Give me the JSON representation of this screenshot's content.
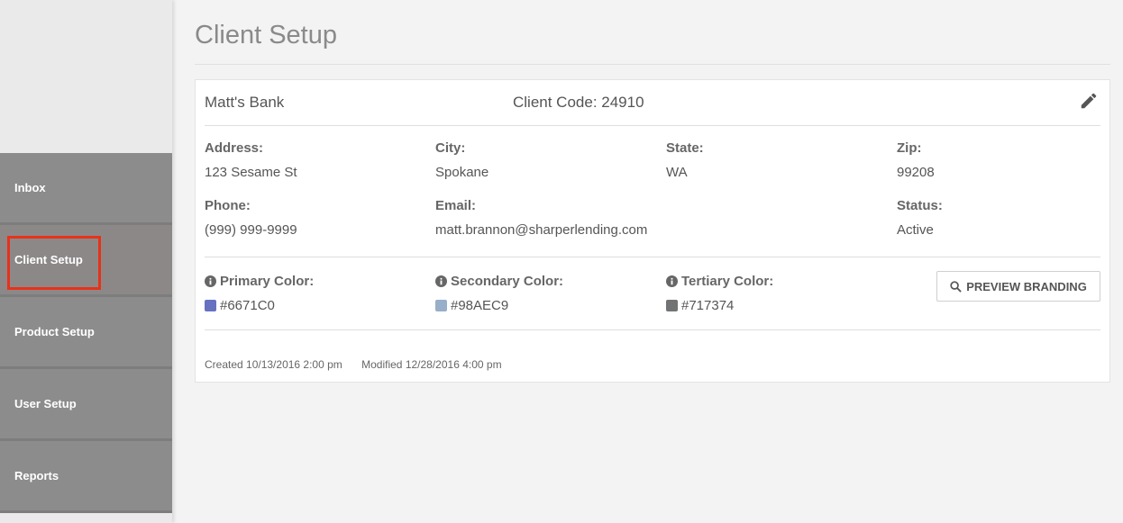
{
  "nav": {
    "items": [
      {
        "label": "Inbox"
      },
      {
        "label": "Client Setup"
      },
      {
        "label": "Product Setup"
      },
      {
        "label": "User Setup"
      },
      {
        "label": "Reports"
      }
    ]
  },
  "page": {
    "title": "Client Setup"
  },
  "client": {
    "name": "Matt's Bank",
    "code": "Client Code: 24910",
    "address_label": "Address:",
    "address": "123 Sesame St",
    "city_label": "City:",
    "city": "Spokane",
    "state_label": "State:",
    "state": "WA",
    "zip_label": "Zip:",
    "zip": "99208",
    "phone_label": "Phone:",
    "phone": "(999) 999-9999",
    "email_label": "Email:",
    "email": "matt.brannon@sharperlending.com",
    "status_label": "Status:",
    "status": "Active"
  },
  "branding": {
    "primary_label": "Primary Color:",
    "primary": "#6671C0",
    "secondary_label": "Secondary Color:",
    "secondary": "#98AEC9",
    "tertiary_label": "Tertiary Color:",
    "tertiary": "#717374",
    "preview_label": "PREVIEW BRANDING"
  },
  "meta": {
    "created": "Created 10/13/2016 2:00 pm",
    "modified": "Modified 12/28/2016 4:00 pm"
  }
}
